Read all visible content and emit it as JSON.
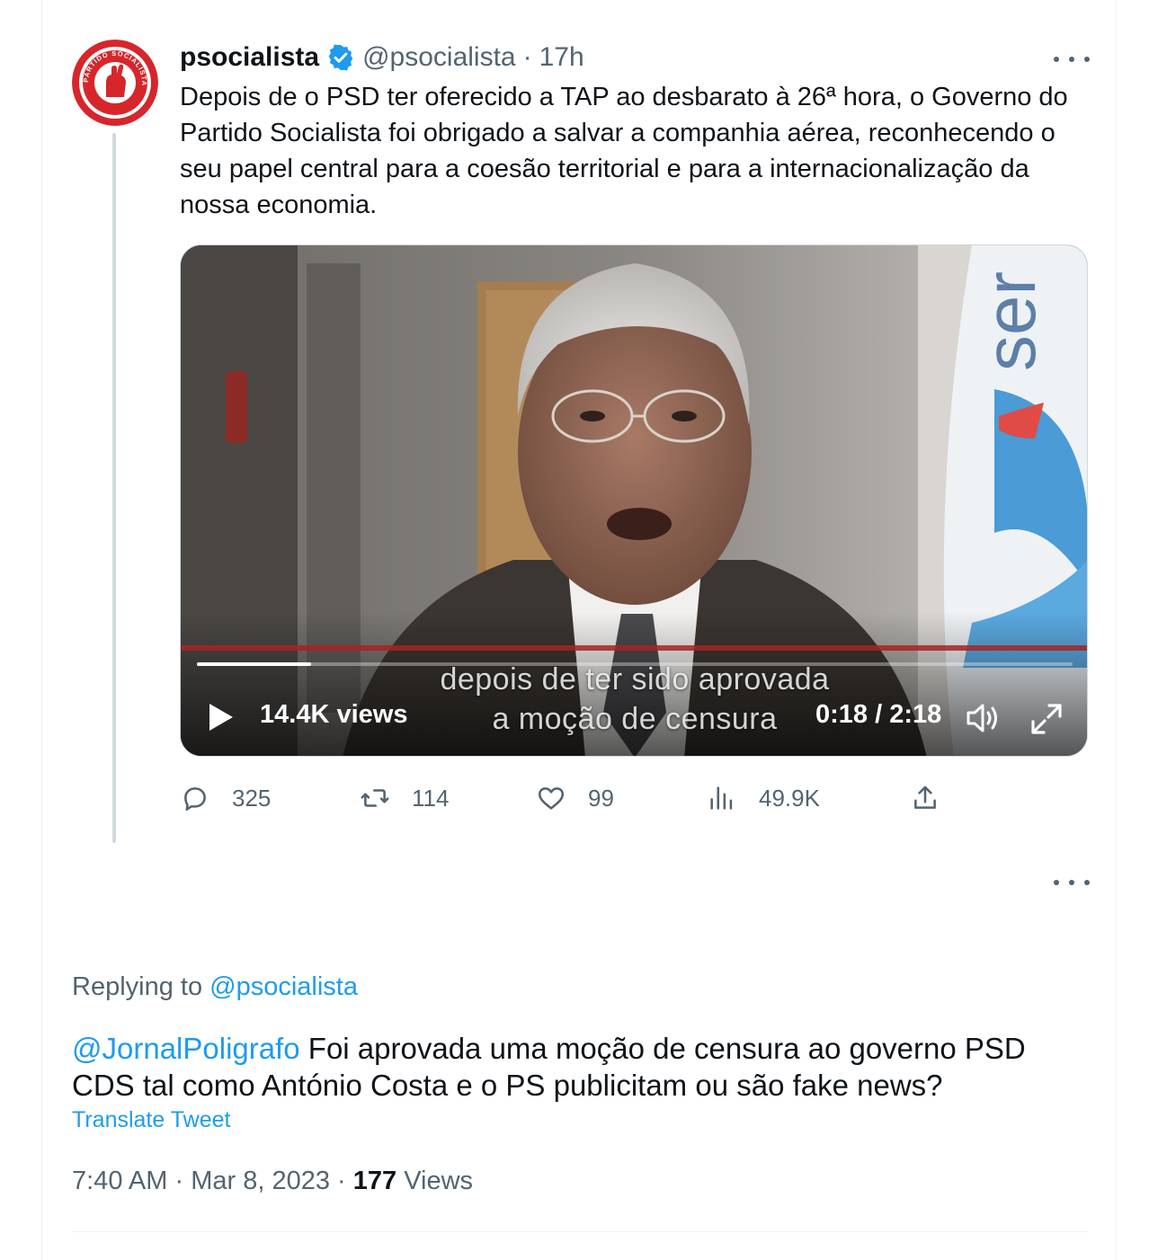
{
  "quoted_tweet": {
    "display_name": "psocialista",
    "handle": "@psocialista",
    "separator": "·",
    "time_ago": "17h",
    "avatar_text": "PARTIDO SOCIALISTA",
    "text": "Depois de o PSD ter oferecido a TAP ao desbarato à 26ª hora, o Governo do Partido Socialista foi obrigado a salvar a companhia aérea, reconhecendo o seu papel central para a coesão territorial e para a internacionalização da nossa economia.",
    "video": {
      "subtitle_line1": "depois de ter sido aprovada",
      "subtitle_line2": "a moção de censura",
      "views": "14.4K views",
      "timecode": "0:18 / 2:18",
      "progress": 0.13,
      "banner_text": "ser"
    },
    "actions": {
      "replies": "325",
      "retweets": "114",
      "likes": "99",
      "views": "49.9K"
    }
  },
  "reply": {
    "replying_to_label": "Replying to",
    "replying_to_handle": "@psocialista",
    "mention": "@JornalPoligrafo",
    "text": " Foi aprovada uma moção de censura ao governo PSD CDS tal como António Costa e o PS publicitam ou são fake news?",
    "translate_label": "Translate Tweet",
    "time": "7:40 AM",
    "date": "Mar 8, 2023",
    "separator": "·",
    "view_count": "177",
    "views_label": "Views"
  },
  "colors": {
    "accent": "#1d9bf0",
    "text_primary": "#0f1419",
    "text_secondary": "#536471",
    "brand_red": "#d6262b"
  }
}
